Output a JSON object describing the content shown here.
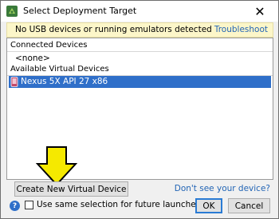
{
  "window": {
    "title": "Select Deployment Target",
    "close_glyph": "✕"
  },
  "warning": {
    "message": "No USB devices or running emulators detected",
    "troubleshoot_link": "Troubleshoot"
  },
  "connected_devices": {
    "header": "Connected Devices",
    "empty_label": "<none>"
  },
  "available_virtual_devices": {
    "header": "Available Virtual Devices",
    "items": [
      {
        "label": "Nexus 5X API 27 x86",
        "selected": true,
        "icon": "phone-icon"
      }
    ]
  },
  "actions": {
    "create_button": "Create New Virtual Device",
    "dont_see_link": "Don't see your device?",
    "ok_button": "OK",
    "cancel_button": "Cancel"
  },
  "footer": {
    "help_glyph": "?",
    "checkbox_label": "Use same selection for future launches",
    "checkbox_checked": false
  },
  "colors": {
    "selection": "#2f6fc9",
    "link": "#2365b5",
    "warning_bg": "#fcf6c9",
    "arrow": "#f5e900"
  }
}
